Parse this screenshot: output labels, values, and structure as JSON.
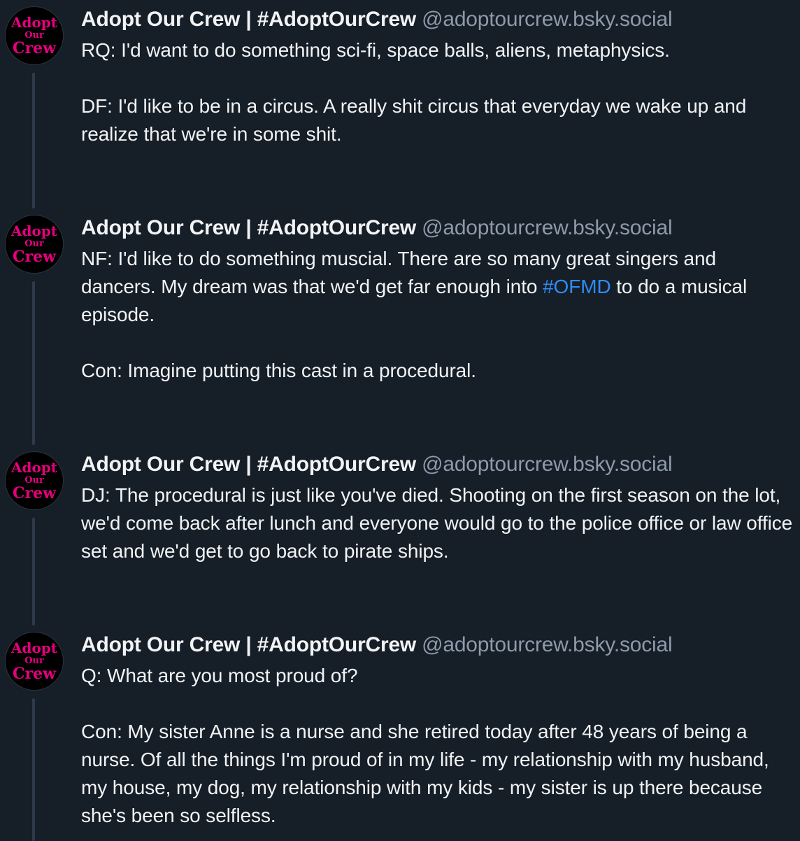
{
  "colors": {
    "background": "#161e27",
    "text": "#f1f3f5",
    "handle": "#8d9aab",
    "link": "#2f8cf6",
    "thread_line": "#2e3a49",
    "avatar_text": "#e6007e"
  },
  "posts": [
    {
      "display_name": "Adopt Our Crew | #AdoptOurCrew",
      "handle": "@adoptourcrew.bsky.social",
      "avatar_icon": "adopt-our-crew-logo",
      "paragraphs": [
        "RQ: I'd want to do something sci-fi, space balls, aliens, metaphysics.",
        "DF: I'd like to be in a circus. A really shit circus that everyday we wake up and realize that we're in some shit."
      ]
    },
    {
      "display_name": "Adopt Our Crew | #AdoptOurCrew",
      "handle": "@adoptourcrew.bsky.social",
      "avatar_icon": "adopt-our-crew-logo",
      "p1_before": "NF: I'd like to do something muscial. There are so many great singers and dancers. My dream was that we'd get far enough into ",
      "p1_hashtag": "#OFMD",
      "p1_after": " to do a musical episode.",
      "p2": "Con: Imagine putting this cast in a procedural."
    },
    {
      "display_name": "Adopt Our Crew | #AdoptOurCrew",
      "handle": "@adoptourcrew.bsky.social",
      "avatar_icon": "adopt-our-crew-logo",
      "paragraphs": [
        "DJ: The procedural is just like you've died. Shooting on the first season on the lot, we'd come back after lunch and everyone would go to the police office or law office set and we'd get to go back to pirate ships."
      ]
    },
    {
      "display_name": "Adopt Our Crew | #AdoptOurCrew",
      "handle": "@adoptourcrew.bsky.social",
      "avatar_icon": "adopt-our-crew-logo",
      "paragraphs": [
        "Q: What are you most proud of?",
        "Con: My sister Anne is a nurse and she retired today after 48 years of being a nurse. Of all the things I'm proud of in my life - my relationship with my husband, my house, my dog, my relationship with my kids - my sister is up there because she's been so selfless."
      ]
    }
  ],
  "avatar_logo": {
    "line1": "Adopt",
    "line2": "Our",
    "line3": "Crew"
  }
}
